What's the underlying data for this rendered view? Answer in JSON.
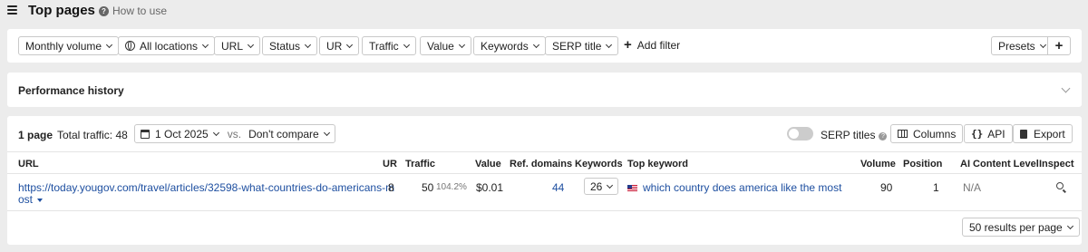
{
  "header": {
    "title": "Top pages",
    "how_to_use": "How to use"
  },
  "filters": {
    "items": [
      "Monthly volume",
      "All locations",
      "URL",
      "Status",
      "UR",
      "Traffic",
      "Value",
      "Keywords",
      "SERP title"
    ],
    "add_filter": "Add filter",
    "presets": "Presets"
  },
  "performance": {
    "title": "Performance history"
  },
  "results": {
    "page_count": "1 page",
    "total_traffic": "Total traffic: 48",
    "date": "1 Oct 2025",
    "vs": "vs.",
    "compare": "Don't compare",
    "serp_titles": "SERP titles",
    "serp_titles_on": false,
    "columns_btn": "Columns",
    "api_btn": "API",
    "export_btn": "Export",
    "columns": [
      "URL",
      "UR",
      "Traffic",
      "Value",
      "Ref. domains",
      "Keywords",
      "Top keyword",
      "Volume",
      "Position",
      "AI Content Level",
      "Inspect"
    ],
    "row": {
      "url_line1": "https://today.yougov.com/travel/articles/32598-what-countries-do-americans-m",
      "url_line2": "ost",
      "ur": "8",
      "traffic": "50",
      "traffic_change": "104.2%",
      "value": "$0.01",
      "ref_domains": "44",
      "keywords": "26",
      "top_keyword": "which country does america like the most",
      "volume": "90",
      "position": "1",
      "ai_content_level": "N/A"
    },
    "per_page": "50 results per page"
  },
  "colors": {
    "link": "#1e4fa0",
    "background": "#ececec",
    "panel": "#ffffff"
  }
}
